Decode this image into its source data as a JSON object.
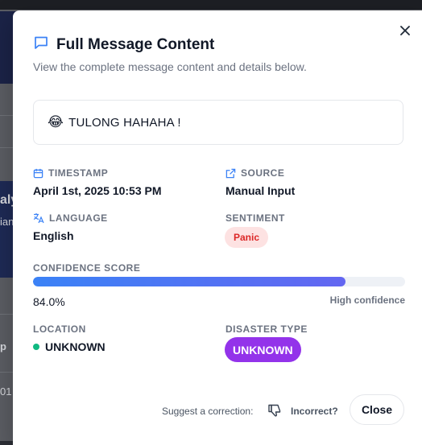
{
  "background": {
    "fragments": [
      "aly",
      "ian",
      "p",
      "01"
    ]
  },
  "modal": {
    "title": "Full Message Content",
    "subtitle": "View the complete message content and details below.",
    "title_icon": "message-square-icon",
    "close_icon": "close-icon"
  },
  "message": {
    "emoji": "😂",
    "text": "TULONG HAHAHA !"
  },
  "details": {
    "timestamp_label": "TIMESTAMP",
    "timestamp_value": "April 1st, 2025 10:53 PM",
    "source_label": "SOURCE",
    "source_value": "Manual Input",
    "language_label": "LANGUAGE",
    "language_value": "English",
    "sentiment_label": "SENTIMENT",
    "sentiment_value": "Panic",
    "confidence_label": "CONFIDENCE SCORE",
    "confidence_value": "84.0%",
    "confidence_fraction": 0.84,
    "confidence_note": "High confidence",
    "location_label": "LOCATION",
    "location_value": "UNKNOWN",
    "disaster_label": "DISASTER TYPE",
    "disaster_value": "UNKNOWN"
  },
  "footer": {
    "suggest_label": "Suggest a correction:",
    "incorrect_label": "Incorrect?",
    "close_label": "Close"
  },
  "colors": {
    "accent_blue": "#3b82f6",
    "panic_bg": "#fde2e2",
    "panic_text": "#dc2626",
    "unknown_bg": "#9333ea",
    "location_dot": "#10b981"
  }
}
